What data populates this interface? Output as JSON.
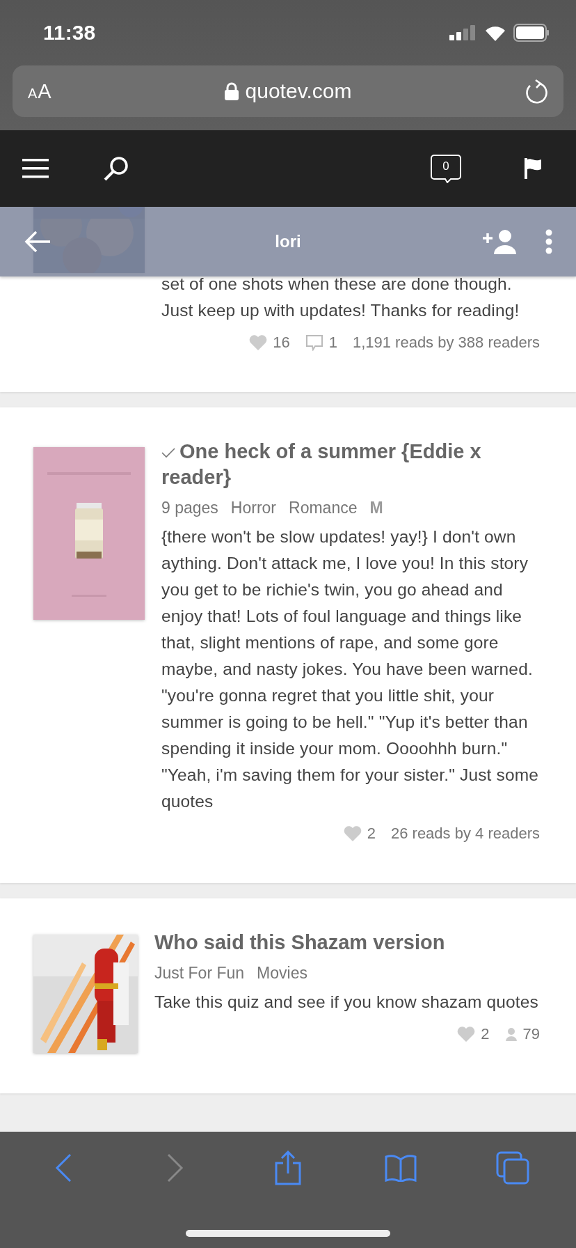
{
  "status_bar": {
    "time": "11:38"
  },
  "address_bar": {
    "text_size_small": "A",
    "text_size_large": "A",
    "url": "quotev.com"
  },
  "nav": {
    "notification_count": "0"
  },
  "profile_bar": {
    "name": "lori"
  },
  "cards": [
    {
      "kind": "story",
      "description": "set of one shots when these are done though. Just keep up with updates! Thanks for reading!",
      "stats": [
        {
          "kind": "likes",
          "text": "16"
        },
        {
          "kind": "comments",
          "text": "1"
        },
        {
          "kind": "reads",
          "text": "1,191 reads by 388 readers"
        }
      ]
    },
    {
      "kind": "story",
      "completed": true,
      "title": "One heck of a summer {Eddie x reader}",
      "tags": [
        {
          "kind": "info",
          "text": "9 pages"
        },
        {
          "kind": "genre",
          "text": "Horror"
        },
        {
          "kind": "genre",
          "text": "Romance"
        },
        {
          "kind": "rating",
          "text": "M"
        }
      ],
      "description": "{there won't be slow updates! yay!} I don't own aything. Don't attack me, I love you! In this story you get to be richie's twin, you go ahead and enjoy that! Lots of foul language and things like that, slight mentions of rape, and some gore maybe, and nasty jokes. You have been warned. \"you're gonna regret that you little shit, your summer is going to be hell.\" \"Yup it's better than spending it inside your mom. Oooohhh burn.\" \"Yeah, i'm saving them for your sister.\" Just some quotes",
      "stats": [
        {
          "kind": "likes",
          "text": "2"
        },
        {
          "kind": "reads",
          "text": "26 reads by 4 readers"
        }
      ]
    },
    {
      "kind": "quiz",
      "completed": false,
      "title": "Who said this Shazam version",
      "tags": [
        {
          "kind": "genre",
          "text": "Just For Fun"
        },
        {
          "kind": "genre",
          "text": "Movies"
        }
      ],
      "description": "Take this quiz and see if you know shazam quotes",
      "stats": [
        {
          "kind": "likes",
          "text": "2"
        },
        {
          "kind": "takers",
          "text": "79"
        }
      ]
    }
  ],
  "toolbar": {
    "buttons": [
      {
        "kind": "back",
        "disabled": false
      },
      {
        "kind": "forward",
        "disabled": true
      },
      {
        "kind": "share",
        "disabled": false
      },
      {
        "kind": "bookmarks",
        "disabled": false
      },
      {
        "kind": "tabs",
        "disabled": false
      }
    ]
  }
}
